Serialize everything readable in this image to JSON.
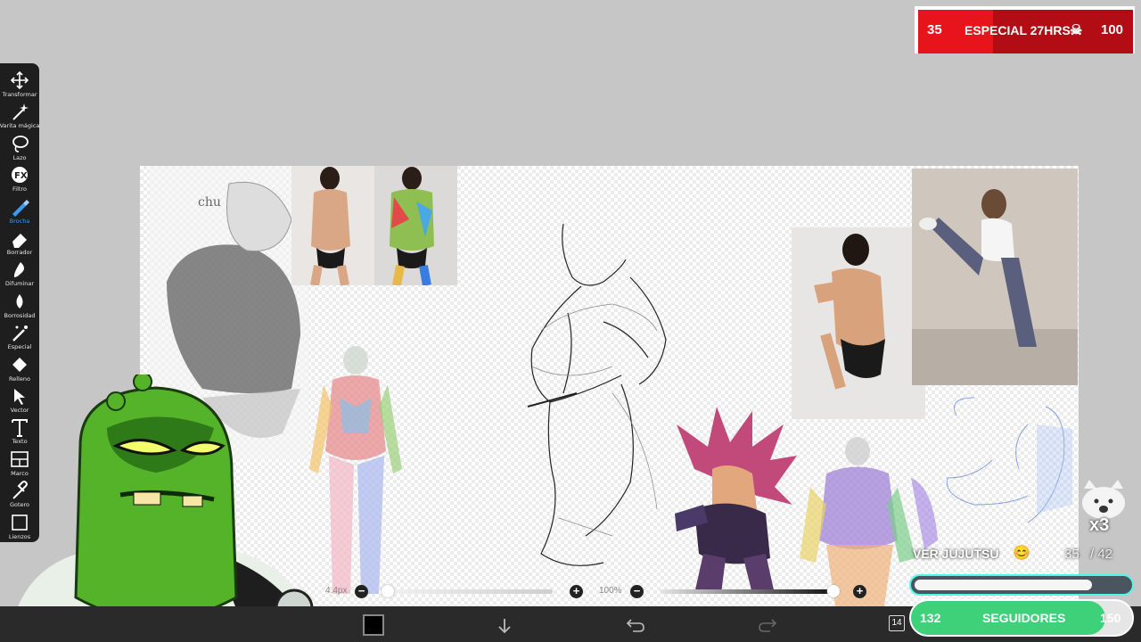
{
  "toolbar": {
    "tools": [
      {
        "label": "Transformar",
        "icon": "move-icon"
      },
      {
        "label": "Varita mágica",
        "icon": "magic-wand-icon"
      },
      {
        "label": "Lazo",
        "icon": "lasso-icon"
      },
      {
        "label": "Filtro",
        "icon": "fx-icon"
      },
      {
        "label": "Brocha",
        "icon": "brush-icon",
        "active": true
      },
      {
        "label": "Borrador",
        "icon": "eraser-icon"
      },
      {
        "label": "Difuminar",
        "icon": "smudge-icon"
      },
      {
        "label": "Borrosidad",
        "icon": "blur-drop-icon"
      },
      {
        "label": "Especial",
        "icon": "special-icon"
      },
      {
        "label": "Relleno",
        "icon": "fill-bucket-icon"
      },
      {
        "label": "Vector",
        "icon": "vector-arrow-icon"
      },
      {
        "label": "Texto",
        "icon": "text-icon"
      },
      {
        "label": "Marco",
        "icon": "frame-icon"
      },
      {
        "label": "Gotero",
        "icon": "eyedropper-icon"
      },
      {
        "label": "Lienzos",
        "icon": "canvas-icon"
      }
    ]
  },
  "canvas": {
    "sketch_note": "chu"
  },
  "sliders": {
    "brush_size": "4.4px",
    "opacity": "100%",
    "size_level": 0.0,
    "opacity_level": 1.0
  },
  "bottombar": {
    "color": "#000000",
    "layer_count": "14"
  },
  "goal_top": {
    "current": "35",
    "label": "ESPECIAL 27HRS",
    "target": "100",
    "accent": "#e8141b"
  },
  "cat_badge": {
    "multiplier": "x3"
  },
  "follow_widget": {
    "ticker": "VER JUJUTSU",
    "progress_text": "35",
    "progress_total": "/ 42",
    "progress_level": 0.83,
    "current": "132",
    "label": "SEGUIDORES",
    "target": "150",
    "accent": "#3fd17a"
  }
}
